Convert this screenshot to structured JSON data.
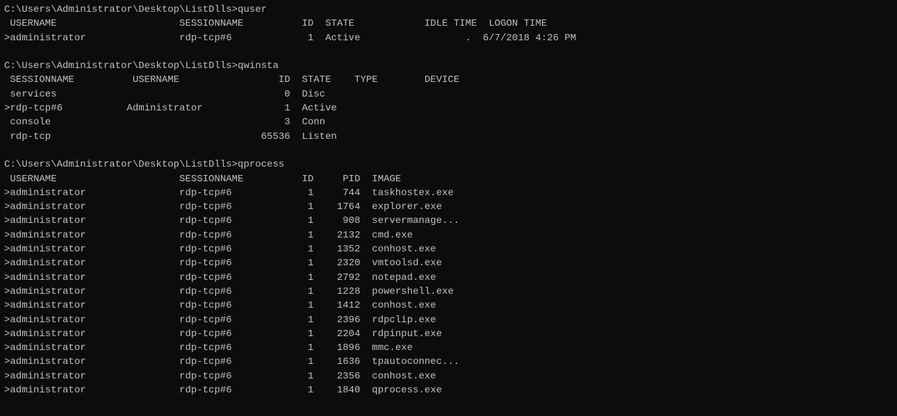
{
  "terminal": {
    "content": [
      "C:\\Users\\Administrator\\Desktop\\ListDlls>quser",
      " USERNAME                     SESSIONNAME          ID  STATE            IDLE TIME  LOGON TIME",
      ">administrator                rdp-tcp#6             1  Active                  .  6/7/2018 4:26 PM",
      "",
      "C:\\Users\\Administrator\\Desktop\\ListDlls>qwinsta",
      " SESSIONNAME          USERNAME                 ID  STATE    TYPE        DEVICE",
      " services                                       0  Disc",
      ">rdp-tcp#6           Administrator              1  Active",
      " console                                        3  Conn",
      " rdp-tcp                                    65536  Listen",
      "",
      "C:\\Users\\Administrator\\Desktop\\ListDlls>qprocess",
      " USERNAME                     SESSIONNAME          ID     PID  IMAGE",
      ">administrator                rdp-tcp#6             1     744  taskhostex.exe",
      ">administrator                rdp-tcp#6             1    1764  explorer.exe",
      ">administrator                rdp-tcp#6             1     908  servermanage...",
      ">administrator                rdp-tcp#6             1    2132  cmd.exe",
      ">administrator                rdp-tcp#6             1    1352  conhost.exe",
      ">administrator                rdp-tcp#6             1    2320  vmtoolsd.exe",
      ">administrator                rdp-tcp#6             1    2792  notepad.exe",
      ">administrator                rdp-tcp#6             1    1228  powershell.exe",
      ">administrator                rdp-tcp#6             1    1412  conhost.exe",
      ">administrator                rdp-tcp#6             1    2396  rdpclip.exe",
      ">administrator                rdp-tcp#6             1    2204  rdpinput.exe",
      ">administrator                rdp-tcp#6             1    1896  mmc.exe",
      ">administrator                rdp-tcp#6             1    1636  tpautoconnec...",
      ">administrator                rdp-tcp#6             1    2356  conhost.exe",
      ">administrator                rdp-tcp#6             1    1840  qprocess.exe"
    ]
  }
}
